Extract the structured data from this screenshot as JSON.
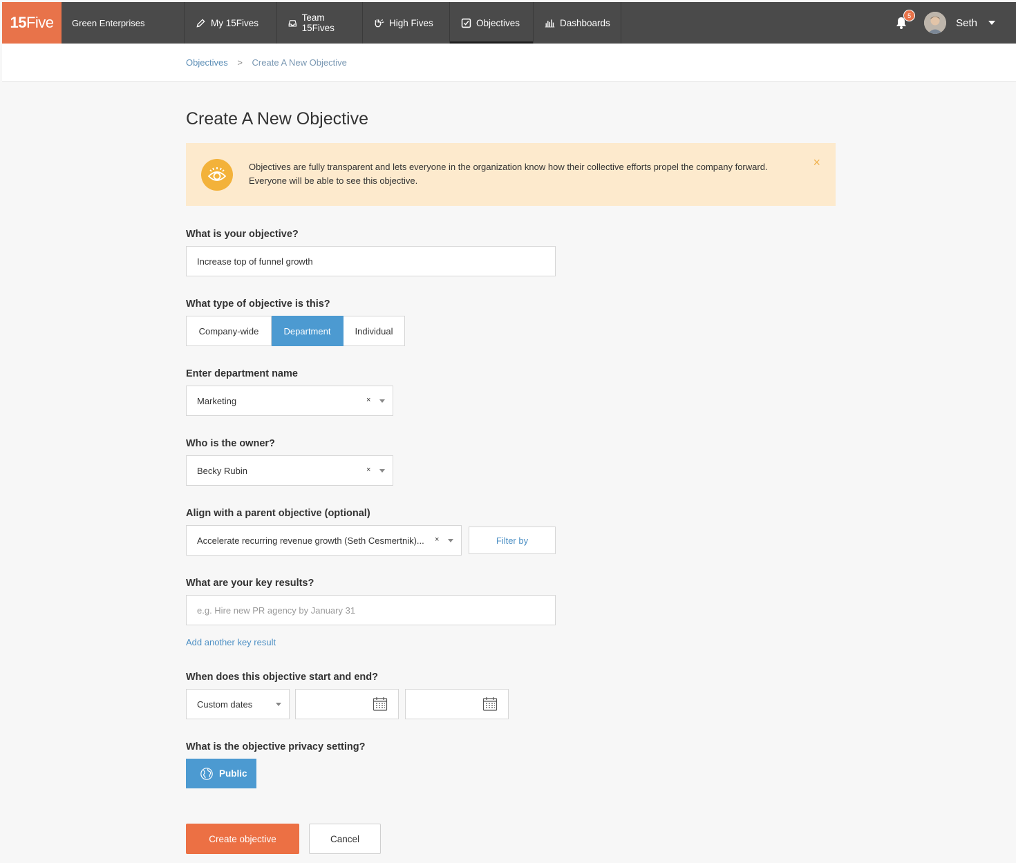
{
  "nav": {
    "logo_bold": "15",
    "logo_light": "Five",
    "org": "Green Enterprises",
    "items": [
      {
        "label": "My 15Fives",
        "icon": "pencil-icon"
      },
      {
        "label": "Team 15Fives",
        "icon": "inbox-icon"
      },
      {
        "label": "High Fives",
        "icon": "high-five-icon"
      },
      {
        "label": "Objectives",
        "icon": "checkbox-icon",
        "active": true
      },
      {
        "label": "Dashboards",
        "icon": "bar-chart-icon"
      }
    ],
    "notifications": "5",
    "user": "Seth"
  },
  "breadcrumb": {
    "root": "Objectives",
    "separator": ">",
    "current": "Create A New Objective"
  },
  "page": {
    "title": "Create A New Objective"
  },
  "banner": {
    "text": "Objectives are fully transparent and lets everyone in the organization know how their collective efforts propel the company forward. Everyone will be able to see this objective.",
    "close": "×"
  },
  "form": {
    "objective_label": "What is your objective?",
    "objective_value": "Increase top of funnel growth",
    "type_label": "What type of objective is this?",
    "type_options": [
      "Company-wide",
      "Department",
      "Individual"
    ],
    "type_selected": "Department",
    "department_label": "Enter department name",
    "department_value": "Marketing",
    "owner_label": "Who is the owner?",
    "owner_value": "Becky Rubin",
    "parent_label": "Align with a parent objective (optional)",
    "parent_value": "Accelerate recurring revenue growth (Seth Cesmertnik)...",
    "filter_label": "Filter by",
    "clear_glyph": "×",
    "key_results_label": "What are your key results?",
    "key_results_placeholder": "e.g. Hire new PR agency by January 31",
    "add_key_result": "Add another key result",
    "dates_label": "When does this objective start and end?",
    "dates_mode": "Custom dates",
    "privacy_label": "What is the objective privacy setting?",
    "privacy_value": "Public",
    "submit": "Create objective",
    "cancel": "Cancel"
  },
  "colors": {
    "nav_bg": "#4a4a4a",
    "brand_orange": "#e8734a",
    "accent_blue": "#4c9ad1",
    "banner_bg": "#fdeacd",
    "banner_icon": "#f3b23a"
  }
}
